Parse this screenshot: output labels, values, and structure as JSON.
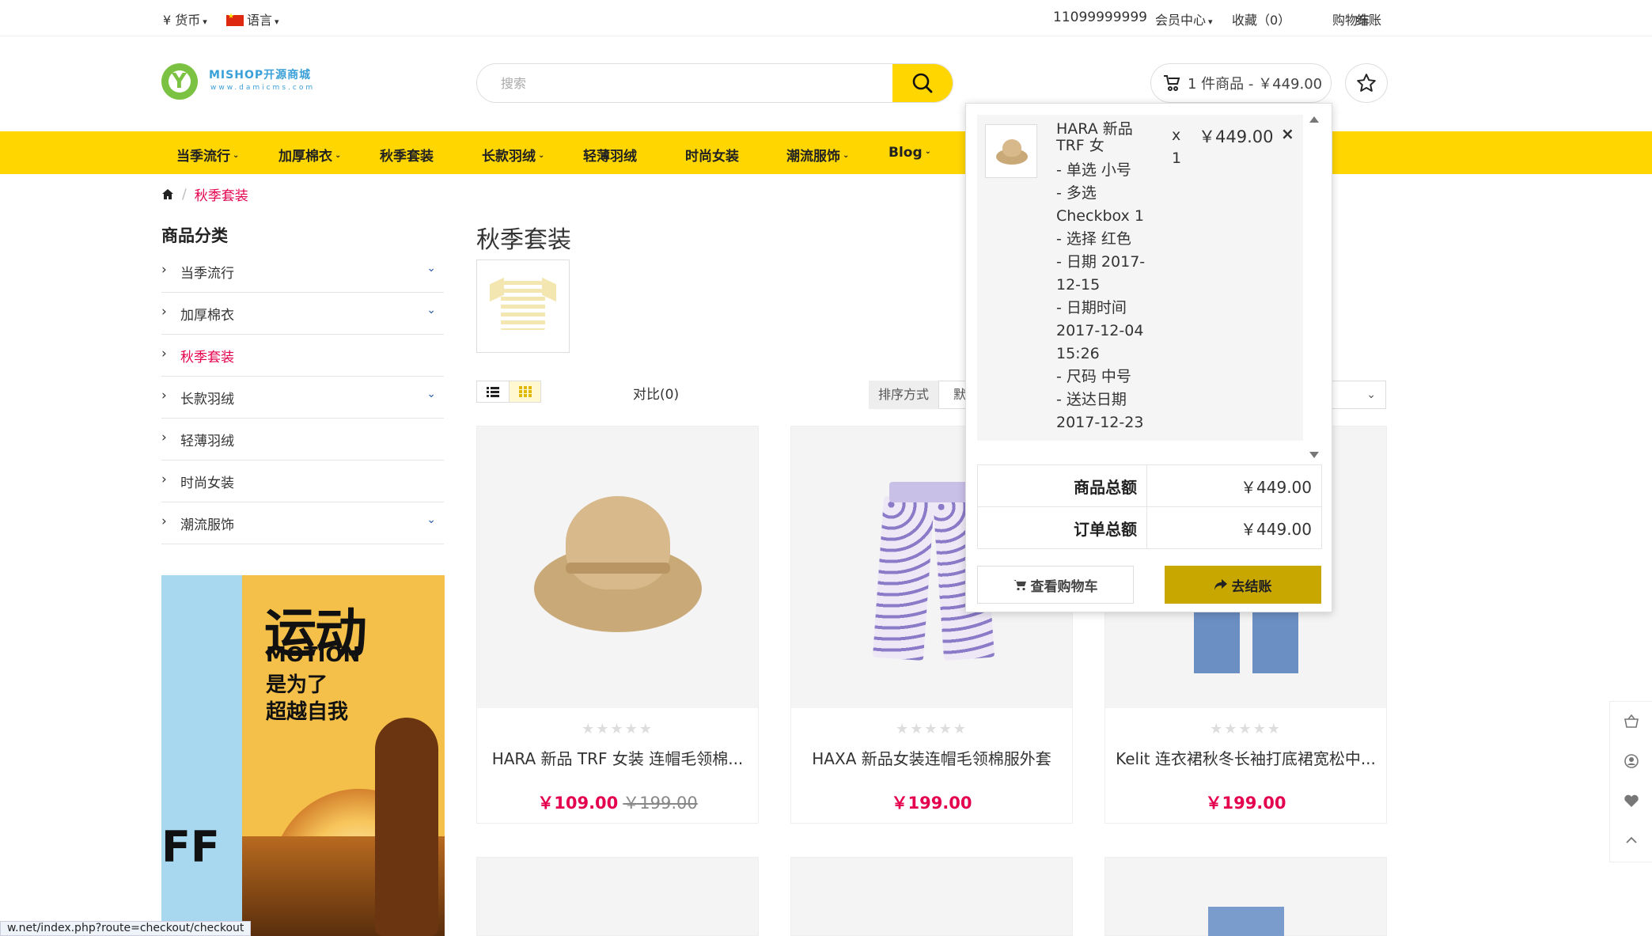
{
  "topbar": {
    "currency": "¥ 货币",
    "language": "语言",
    "phone": "11099999999",
    "member_center": "会员中心",
    "favorites": "收藏（0）",
    "cart": "购物车",
    "checkout": "结账"
  },
  "header": {
    "logo_text": "MISHOP开源商城",
    "logo_sub": "www.damicms.com",
    "search_placeholder": "搜索",
    "cart_summary": "1 件商品 - ￥449.00"
  },
  "nav": {
    "items": [
      {
        "label": "当季流行",
        "has_dropdown": true
      },
      {
        "label": "加厚棉衣",
        "has_dropdown": true
      },
      {
        "label": "秋季套装",
        "has_dropdown": false
      },
      {
        "label": "长款羽绒",
        "has_dropdown": true
      },
      {
        "label": "轻薄羽绒",
        "has_dropdown": false
      },
      {
        "label": "时尚女装",
        "has_dropdown": false
      },
      {
        "label": "潮流服饰",
        "has_dropdown": true
      },
      {
        "label": "Blog",
        "has_dropdown": true
      }
    ]
  },
  "breadcrumb": {
    "current": "秋季套装"
  },
  "sidebar": {
    "title": "商品分类",
    "categories": [
      {
        "label": "当季流行",
        "expandable": true,
        "active": false
      },
      {
        "label": "加厚棉衣",
        "expandable": true,
        "active": false
      },
      {
        "label": "秋季套装",
        "expandable": false,
        "active": true
      },
      {
        "label": "长款羽绒",
        "expandable": true,
        "active": false
      },
      {
        "label": "轻薄羽绒",
        "expandable": false,
        "active": false
      },
      {
        "label": "时尚女装",
        "expandable": false,
        "active": false
      },
      {
        "label": "潮流服饰",
        "expandable": true,
        "active": false
      }
    ],
    "banner": {
      "line1": "运动",
      "line2": "MOTION",
      "line3": "是为了",
      "line4": "超越自我",
      "fragment": "FF"
    }
  },
  "main": {
    "title": "秋季套装",
    "compare": "对比(0)",
    "sort_label": "排序方式",
    "sort_value": "默",
    "products": [
      {
        "name": "HARA 新品 TRF 女装 连帽毛领棉...",
        "price": "￥109.00",
        "old_price": "￥199.00"
      },
      {
        "name": "HAXA 新品女装连帽毛领棉服外套",
        "price": "￥199.00",
        "old_price": ""
      },
      {
        "name": "Kelit 连衣裙秋冬长袖打底裙宽松中...",
        "price": "￥199.00",
        "old_price": ""
      }
    ]
  },
  "cart_popup": {
    "item": {
      "name": "HARA 新品 TRF 女",
      "options": [
        "- 单选 小号",
        "- 多选 Checkbox 1",
        "- 选择 红色",
        "- 日期 2017-12-15",
        "- 日期时间 2017-12-04 15:26",
        "- 尺码 中号",
        "- 送达日期 2017-12-23"
      ],
      "qty": "x 1",
      "price": "￥449.00",
      "remove": "×"
    },
    "subtotal_label": "商品总额",
    "subtotal_value": "￥449.00",
    "total_label": "订单总额",
    "total_value": "￥449.00",
    "view_cart": "查看购物车",
    "checkout": "去结账"
  },
  "status_url": "w.net/index.php?route=checkout/checkout",
  "colors": {
    "accent": "#ffd600",
    "price": "#e4004f",
    "checkout_btn": "#c8a800"
  }
}
